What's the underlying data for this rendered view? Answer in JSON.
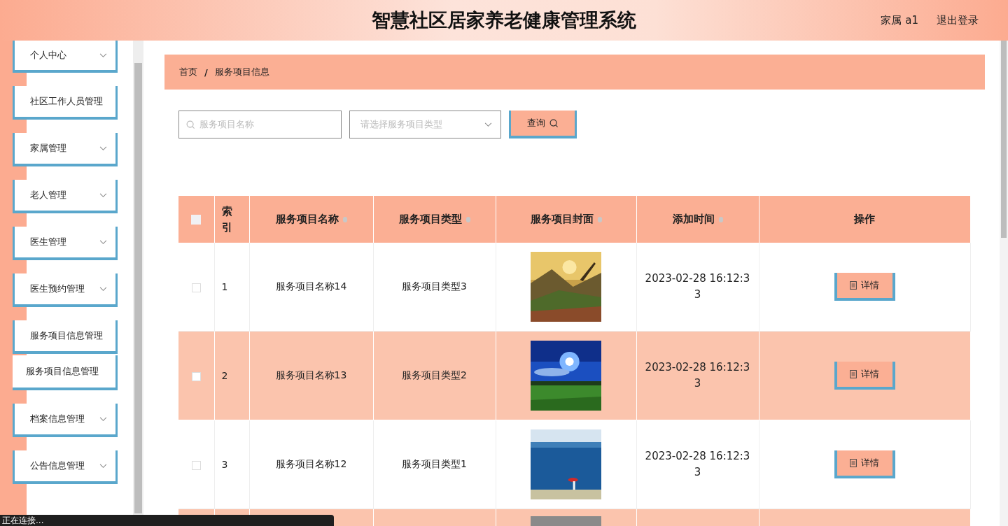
{
  "header": {
    "title": "智慧社区居家养老健康管理系统",
    "user": "家属 a1",
    "logout": "退出登录"
  },
  "sidebar": {
    "items": [
      {
        "label": "个人中心",
        "has_arrow": true
      },
      {
        "label": "社区工作人员管理",
        "has_arrow": false
      },
      {
        "label": "家属管理",
        "has_arrow": true
      },
      {
        "label": "老人管理",
        "has_arrow": true
      },
      {
        "label": "医生管理",
        "has_arrow": true
      },
      {
        "label": "医生预约管理",
        "has_arrow": true
      },
      {
        "label": "服务项目信息管理",
        "has_arrow": false,
        "children": [
          {
            "label": "服务项目信息管理"
          }
        ]
      },
      {
        "label": "档案信息管理",
        "has_arrow": true
      },
      {
        "label": "公告信息管理",
        "has_arrow": true
      }
    ]
  },
  "breadcrumb": {
    "items": [
      "首页",
      "服务项目信息"
    ],
    "separator": "/"
  },
  "search": {
    "name_placeholder": "服务项目名称",
    "type_placeholder": "请选择服务项目类型",
    "button": "查询"
  },
  "table": {
    "columns": [
      {
        "kind": "checkbox",
        "checked": false
      },
      {
        "kind": "text",
        "label": "索引",
        "sortable": false
      },
      {
        "kind": "text",
        "label": "服务项目名称",
        "sortable": true
      },
      {
        "kind": "text",
        "label": "服务项目类型",
        "sortable": true
      },
      {
        "kind": "text",
        "label": "服务项目封面",
        "sortable": true
      },
      {
        "kind": "text",
        "label": "添加时间",
        "sortable": true
      },
      {
        "kind": "text",
        "label": "操作",
        "sortable": false
      }
    ],
    "rows": [
      {
        "checked": false,
        "highlighted": false,
        "index": "1",
        "name": "服务项目名称14",
        "type": "服务项目类型3",
        "time": "2023-02-28 16:12:33",
        "action": "详情"
      },
      {
        "checked": false,
        "highlighted": true,
        "index": "2",
        "name": "服务项目名称13",
        "type": "服务项目类型2",
        "time": "2023-02-28 16:12:33",
        "action": "详情"
      },
      {
        "checked": false,
        "highlighted": false,
        "index": "3",
        "name": "服务项目名称12",
        "type": "服务项目类型1",
        "time": "2023-02-28 16:12:33",
        "action": "详情"
      },
      {
        "highlighted": true
      }
    ]
  },
  "status_bar": {
    "text": "正在连接..."
  }
}
